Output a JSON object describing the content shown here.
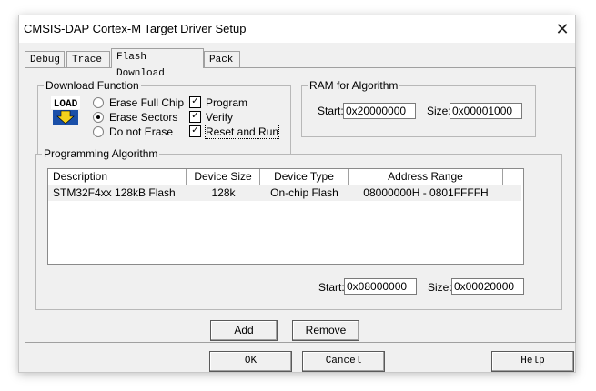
{
  "window": {
    "title": "CMSIS-DAP Cortex-M Target Driver Setup",
    "close_glyph": "✕"
  },
  "tabs": [
    {
      "label": "Debug",
      "active": false
    },
    {
      "label": "Trace",
      "active": false
    },
    {
      "label": "Flash Download",
      "active": true
    },
    {
      "label": "Pack",
      "active": false
    }
  ],
  "download_function": {
    "group_label": "Download Function",
    "icon_text": "LOAD",
    "radios": [
      {
        "label": "Erase Full Chip",
        "selected": false
      },
      {
        "label": "Erase Sectors",
        "selected": true
      },
      {
        "label": "Do not Erase",
        "selected": false
      }
    ],
    "checks": [
      {
        "label": "Program",
        "checked": true
      },
      {
        "label": "Verify",
        "checked": true
      },
      {
        "label": "Reset and Run",
        "checked": true
      }
    ],
    "check_glyph": "✓"
  },
  "ram": {
    "group_label": "RAM for Algorithm",
    "start_label": "Start:",
    "start_value": "0x20000000",
    "size_label": "Size:",
    "size_value": "0x00001000"
  },
  "algorithm": {
    "group_label": "Programming Algorithm",
    "columns": [
      "Description",
      "Device Size",
      "Device Type",
      "Address Range"
    ],
    "rows": [
      {
        "description": "STM32F4xx 128kB Flash",
        "size": "128k",
        "type": "On-chip Flash",
        "range": "08000000H - 0801FFFFH"
      }
    ],
    "start_label": "Start:",
    "start_value": "0x08000000",
    "size_label": "Size:",
    "size_value": "0x00020000"
  },
  "buttons": {
    "add": "Add",
    "remove": "Remove",
    "ok": "OK",
    "cancel": "Cancel",
    "help": "Help"
  }
}
